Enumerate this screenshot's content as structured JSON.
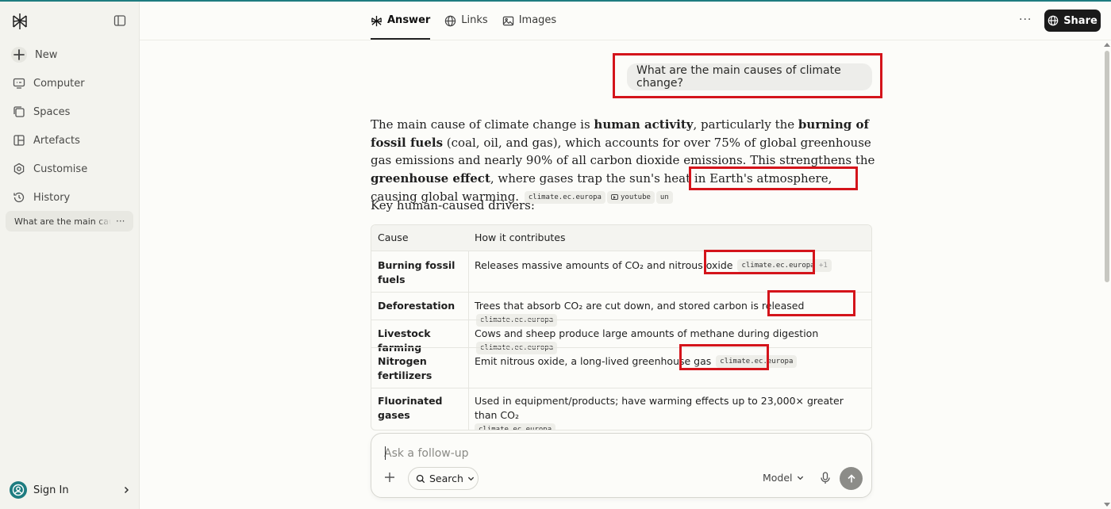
{
  "sidebar": {
    "items": [
      {
        "label": "New",
        "icon": "plus-icon"
      },
      {
        "label": "Computer",
        "icon": "monitor-icon"
      },
      {
        "label": "Spaces",
        "icon": "spaces-icon"
      },
      {
        "label": "Artefacts",
        "icon": "artefacts-icon"
      },
      {
        "label": "Customise",
        "icon": "customise-icon"
      },
      {
        "label": "History",
        "icon": "history-icon"
      }
    ],
    "history_item": "What are the main causes",
    "sign_in": "Sign In"
  },
  "header": {
    "tabs": [
      {
        "label": "Answer",
        "icon": "answer-icon",
        "active": true
      },
      {
        "label": "Links",
        "icon": "globe-icon",
        "active": false
      },
      {
        "label": "Images",
        "icon": "image-icon",
        "active": false
      }
    ],
    "more": "···",
    "share": "Share"
  },
  "query": "What are the main causes of climate change?",
  "answer": {
    "p1": "The main cause of climate change is ",
    "b1": "human activity",
    "p2": ", particularly the ",
    "b2": "burning of fossil fuels",
    "p3": " (coal, oil, and gas), which accounts for over 75% of global greenhouse gas emissions and nearly 90% of all carbon dioxide emissions. This strengthens the ",
    "b3": "greenhouse effect",
    "p4": ", where gases trap the sun's heat in Earth's atmosphere, causing global warming.",
    "citations": [
      "climate.ec.europa",
      "youtube",
      "un"
    ]
  },
  "key_drivers": "Key human-caused drivers:",
  "table": {
    "headers": [
      "Cause",
      "How it contributes"
    ],
    "rows": [
      {
        "cause": "Burning fossil fuels",
        "how": "Releases massive amounts of CO₂ and nitrous oxide",
        "cite": "climate.ec.europa",
        "cite_extra": "+1"
      },
      {
        "cause": "Deforestation",
        "how": "Trees that absorb CO₂ are cut down, and stored carbon is released",
        "cite": "climate.ec.europa"
      },
      {
        "cause": "Livestock farming",
        "how": "Cows and sheep produce large amounts of methane during digestion",
        "cite": "climate.ec.europa"
      },
      {
        "cause": "Nitrogen fertilizers",
        "how": "Emit nitrous oxide, a long-lived greenhouse gas",
        "cite": "climate.ec.europa"
      },
      {
        "cause": "Fluorinated gases",
        "how": "Used in equipment/products; have warming effects up to 23,000× greater than CO₂",
        "cite": "climate.ec.europa"
      }
    ]
  },
  "input": {
    "placeholder": "Ask a follow-up",
    "search": "Search",
    "model": "Model"
  },
  "colors": {
    "accent": "#1e7c80",
    "highlight": "#d4141b",
    "share_bg": "#1a1a1a"
  }
}
